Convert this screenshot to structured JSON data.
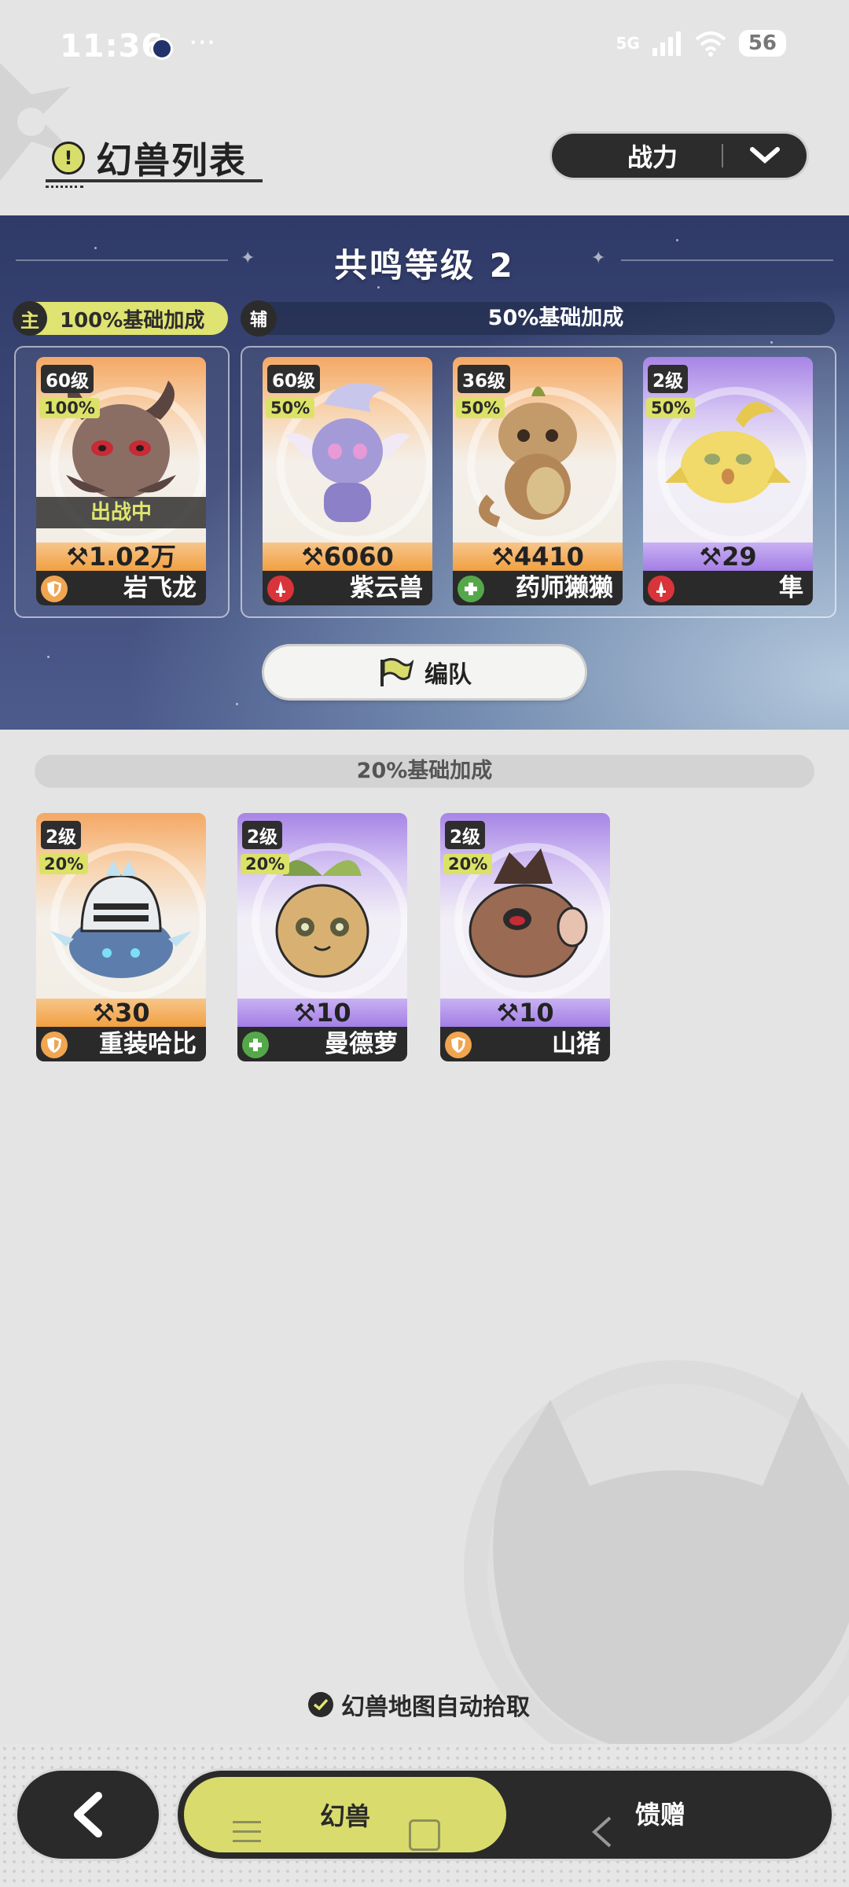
{
  "status_bar": {
    "time": "11:36",
    "more_glyph": "···",
    "network": "5G",
    "battery": "56",
    "icons": [
      "app-notification-icon",
      "signal-icon",
      "wifi-icon",
      "battery-icon"
    ]
  },
  "header": {
    "title": "幻兽列表",
    "title_icon_glyph": "!",
    "sort": {
      "label": "战力",
      "icon": "chevron-down-icon"
    }
  },
  "resonance": {
    "title": "共鸣等级 2",
    "main_tag": "主",
    "main_bonus": "100%基础加成",
    "assist_tag": "辅",
    "assist_bonus": "50%基础加成"
  },
  "team_cards": [
    {
      "level": "60级",
      "bonus": "100%",
      "power": "1.02万",
      "name": "岩飞龙",
      "role": "tank",
      "status": "出战中",
      "theme": "orange"
    },
    {
      "level": "60级",
      "bonus": "50%",
      "power": "6060",
      "name": "紫云兽",
      "role": "attack",
      "theme": "orange"
    },
    {
      "level": "36级",
      "bonus": "50%",
      "power": "4410",
      "name": "药师獭獭",
      "role": "heal",
      "theme": "orange"
    },
    {
      "level": "2级",
      "bonus": "50%",
      "power": "29",
      "name": "隼",
      "role": "attack",
      "theme": "purple"
    }
  ],
  "team_button": {
    "label": "编队",
    "icon": "flag-icon"
  },
  "reserve": {
    "bonus": "20%基础加成",
    "cards": [
      {
        "level": "2级",
        "bonus": "20%",
        "power": "30",
        "name": "重装哈比",
        "role": "tank",
        "theme": "orange"
      },
      {
        "level": "2级",
        "bonus": "20%",
        "power": "10",
        "name": "曼德萝",
        "role": "heal",
        "theme": "purple"
      },
      {
        "level": "2级",
        "bonus": "20%",
        "power": "10",
        "name": "山猪",
        "role": "tank",
        "theme": "purple"
      }
    ]
  },
  "auto_pickup": {
    "label": "幻兽地图自动拾取",
    "checked": true
  },
  "bottom_nav": {
    "back_icon": "back-chevron-icon",
    "tabs": [
      {
        "label": "幻兽",
        "active": true
      },
      {
        "label": "馈赠",
        "active": false
      }
    ]
  },
  "colors": {
    "accent": "#dce268",
    "dark": "#2a2a2a",
    "orange_card": "#f1a040",
    "purple_card": "#a37ee6",
    "tank_role": "#f0a550",
    "attack_role": "#d8343a",
    "heal_role": "#55a84a"
  }
}
